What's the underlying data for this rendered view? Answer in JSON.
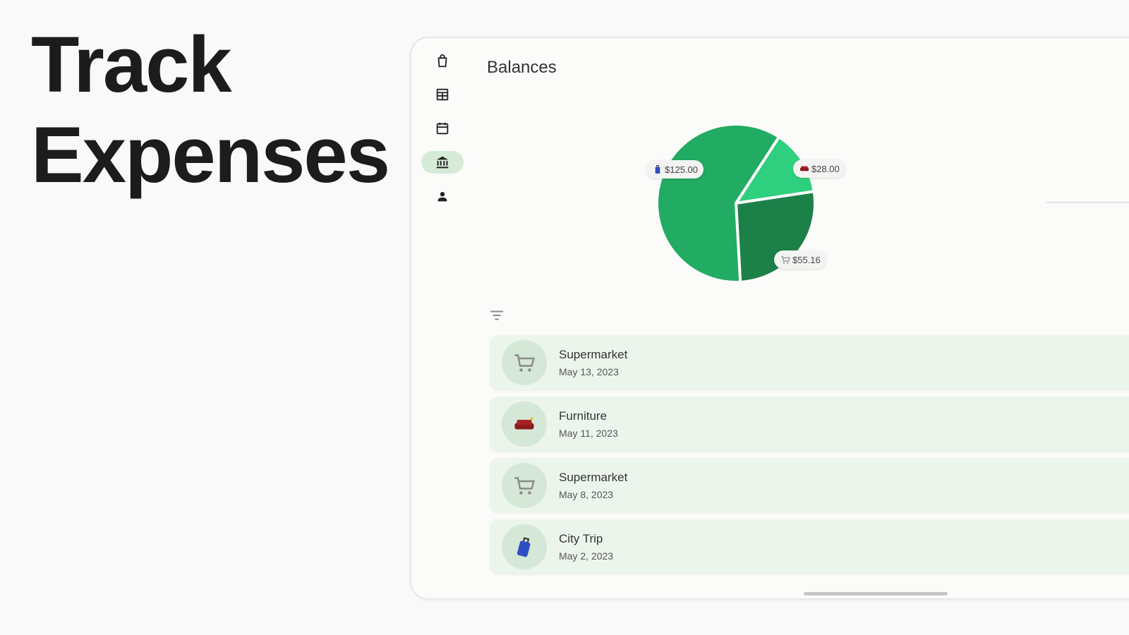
{
  "hero": {
    "line1": "Track",
    "line2": "Expenses"
  },
  "nav": {
    "items": [
      {
        "icon": "shopping-bag-icon",
        "active": false
      },
      {
        "icon": "table-icon",
        "active": false
      },
      {
        "icon": "calendar-icon",
        "active": false
      },
      {
        "icon": "bank-icon",
        "active": true
      },
      {
        "icon": "person-icon",
        "active": false
      }
    ]
  },
  "page": {
    "title": "Balances"
  },
  "chart_data": {
    "type": "pie",
    "slices": [
      {
        "label": "$125.00",
        "value": 125.0,
        "icon": "luggage-icon",
        "color": "#22ab62"
      },
      {
        "label": "$28.00",
        "value": 28.0,
        "icon": "sofa-icon",
        "color": "#2ecf7e"
      },
      {
        "label": "$55.16",
        "value": 55.16,
        "icon": "cart-icon",
        "color": "#1c8049"
      }
    ]
  },
  "transactions": [
    {
      "title": "Supermarket",
      "date": "May 13, 2023",
      "icon": "cart-icon"
    },
    {
      "title": "Furniture",
      "date": "May 11, 2023",
      "icon": "sofa-icon"
    },
    {
      "title": "Supermarket",
      "date": "May 8, 2023",
      "icon": "cart-icon"
    },
    {
      "title": "City Trip",
      "date": "May 2, 2023",
      "icon": "luggage-icon"
    }
  ],
  "colors": {
    "accent": "#22ab62",
    "row_background": "#ecf5ec",
    "active_nav": "#d5ebd8"
  }
}
